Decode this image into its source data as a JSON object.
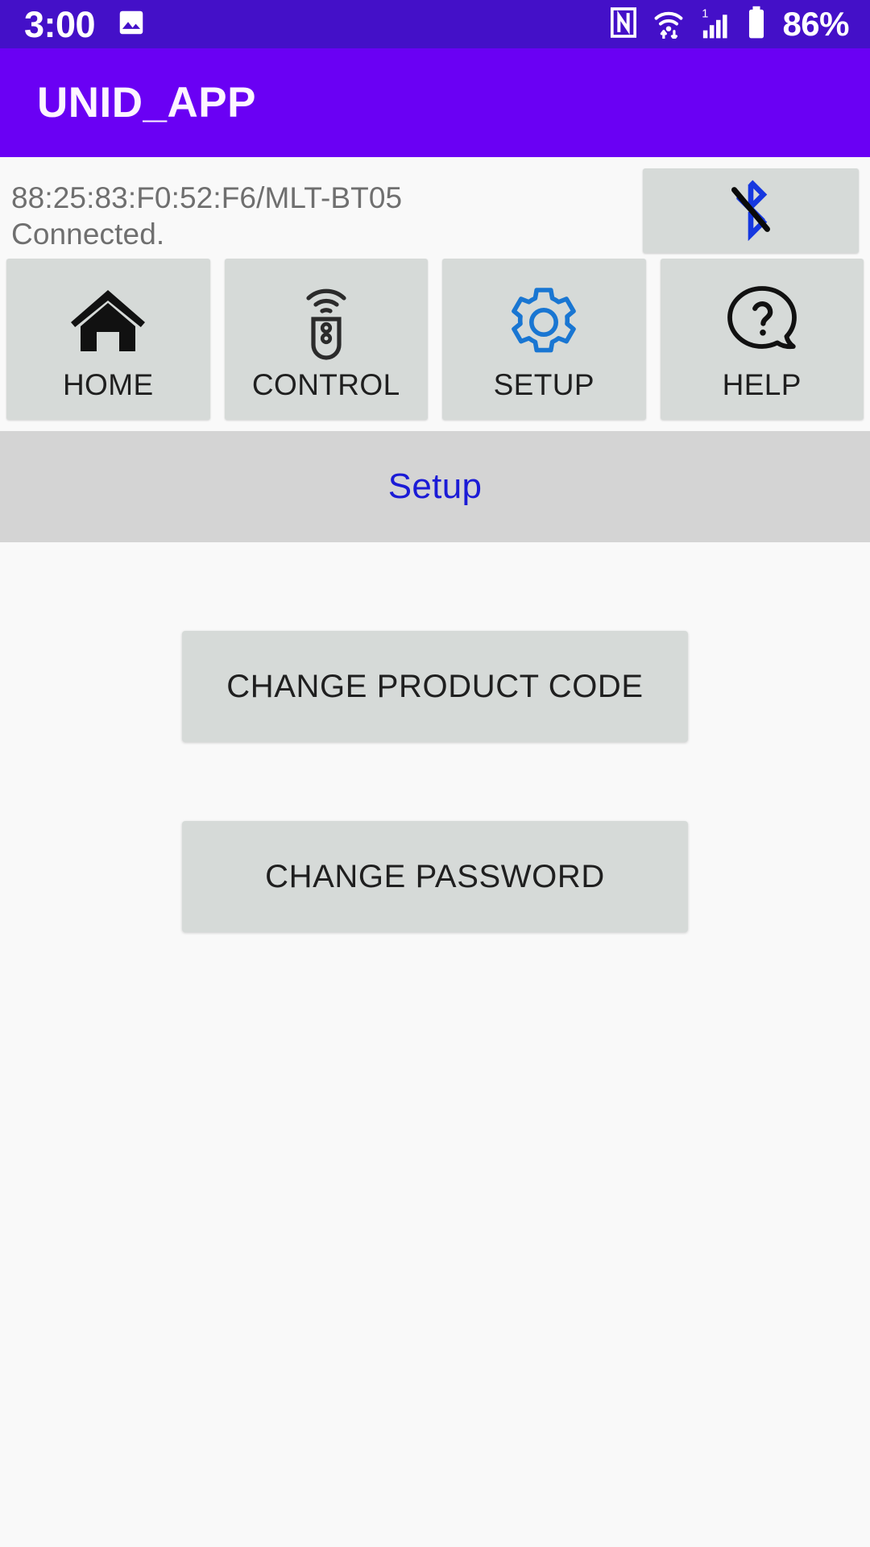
{
  "status_bar": {
    "clock": "3:00",
    "battery_percent": "86%",
    "icons": {
      "gallery": "image-icon",
      "nfc": "nfc-icon",
      "wifi": "wifi-icon",
      "signal": "cellular-signal-icon",
      "signal_badge": "1",
      "battery": "battery-icon"
    },
    "background_color": "#4410c8"
  },
  "app_bar": {
    "title": "UNID_APP",
    "background_color": "#6a00f4"
  },
  "connection": {
    "device_line": "88:25:83:F0:52:F6/MLT-BT05",
    "status_line": "Connected.",
    "bluetooth_button_icon": "bluetooth-disabled-icon",
    "bluetooth_icon_color": "#1638e0"
  },
  "nav": {
    "items": [
      {
        "label": "HOME",
        "icon": "home-icon",
        "icon_color": "#111111",
        "active": false
      },
      {
        "label": "CONTROL",
        "icon": "remote-control-icon",
        "icon_color": "#2b2b2b",
        "active": false
      },
      {
        "label": "SETUP",
        "icon": "gear-icon",
        "icon_color": "#1976d2",
        "active": true
      },
      {
        "label": "HELP",
        "icon": "help-bubble-icon",
        "icon_color": "#111111",
        "active": false
      }
    ]
  },
  "section": {
    "title": "Setup",
    "title_color": "#1b1bd6",
    "background_color": "#d4d4d4"
  },
  "main": {
    "buttons": [
      {
        "label": "CHANGE PRODUCT CODE"
      },
      {
        "label": "CHANGE PASSWORD"
      }
    ]
  }
}
